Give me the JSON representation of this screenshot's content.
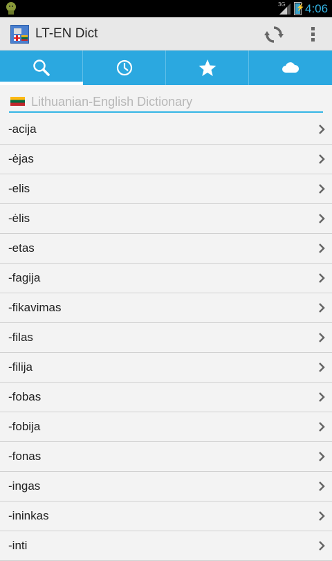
{
  "status_bar": {
    "network": "3G",
    "time": "4:06"
  },
  "action_bar": {
    "title": "LT-EN Dict",
    "icons": [
      "app-icon",
      "refresh-icon",
      "overflow-menu-icon"
    ]
  },
  "tabs": [
    {
      "icon": "search-icon",
      "active": true
    },
    {
      "icon": "history-clock-icon",
      "active": false
    },
    {
      "icon": "star-icon",
      "active": false
    },
    {
      "icon": "cloud-icon",
      "active": false
    }
  ],
  "search": {
    "placeholder": "Lithuanian-English Dictionary",
    "value": ""
  },
  "words": [
    "-acija",
    "-ėjas",
    "-elis",
    "-ėlis",
    "-etas",
    "-fagija",
    "-fikavimas",
    "-filas",
    "-filija",
    "-fobas",
    "-fobija",
    "-fonas",
    "-ingas",
    "-ininkas",
    "-inti"
  ],
  "colors": {
    "tab_bar": "#2ba8e0",
    "accent": "#33b5e5",
    "action_bar": "#e8e8e8",
    "background": "#f3f3f3"
  }
}
